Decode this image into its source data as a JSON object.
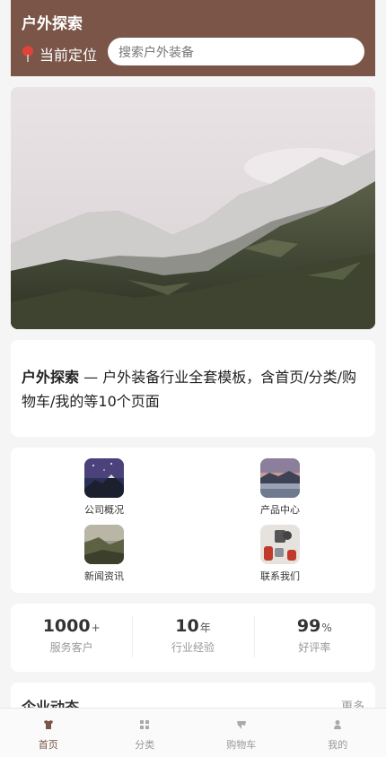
{
  "header": {
    "title": "户外探索",
    "location_label": "当前定位",
    "search_placeholder": "搜索户外装备"
  },
  "intro": {
    "brand": "户外探索",
    "text": " — 户外装备行业全套模板，含首页/分类/购物车/我的等10个页面"
  },
  "quick_links": [
    {
      "label": "公司概况",
      "icon": "mountain-night-icon"
    },
    {
      "label": "产品中心",
      "icon": "lake-sunset-icon"
    },
    {
      "label": "新闻资讯",
      "icon": "valley-icon"
    },
    {
      "label": "联系我们",
      "icon": "gear-flatlay-icon"
    }
  ],
  "stats": [
    {
      "value": "1000",
      "unit": "+",
      "label": "服务客户"
    },
    {
      "value": "10",
      "unit": "年",
      "label": "行业经验"
    },
    {
      "value": "99",
      "unit": "%",
      "label": "好评率"
    }
  ],
  "news": {
    "title": "企业动态",
    "more": "更多"
  },
  "tabbar": [
    {
      "label": "首页",
      "icon": "shirt-icon",
      "active": true
    },
    {
      "label": "分类",
      "icon": "grid-icon",
      "active": false
    },
    {
      "label": "购物车",
      "icon": "cart-icon",
      "active": false
    },
    {
      "label": "我的",
      "icon": "user-icon",
      "active": false
    }
  ],
  "colors": {
    "brand": "#7a5548",
    "background": "#f5f5f5"
  }
}
